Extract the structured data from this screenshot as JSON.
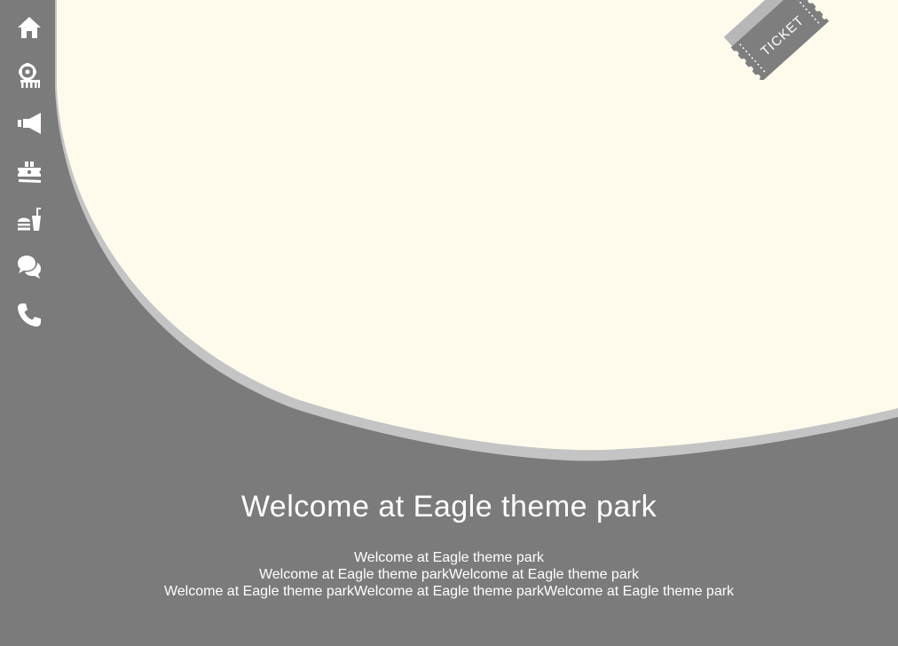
{
  "colors": {
    "background": "#7b7b7b",
    "panel": "#fffbec",
    "panel_shadow": "#c4c4c4",
    "icon": "#ffffff",
    "ticket": "#7e7e7e"
  },
  "sidebar": {
    "items": [
      {
        "icon": "home-icon"
      },
      {
        "icon": "ferris-wheel-icon"
      },
      {
        "icon": "megaphone-icon"
      },
      {
        "icon": "tickets-icon"
      },
      {
        "icon": "food-drink-icon"
      },
      {
        "icon": "chat-icon"
      },
      {
        "icon": "phone-icon"
      }
    ]
  },
  "ticket": {
    "label": "TICKET"
  },
  "welcome": {
    "title": "Welcome at Eagle theme park",
    "lines": [
      "Welcome at Eagle theme park",
      "Welcome at Eagle theme parkWelcome at Eagle theme park",
      "Welcome at Eagle theme parkWelcome at Eagle theme parkWelcome at Eagle theme park"
    ]
  }
}
